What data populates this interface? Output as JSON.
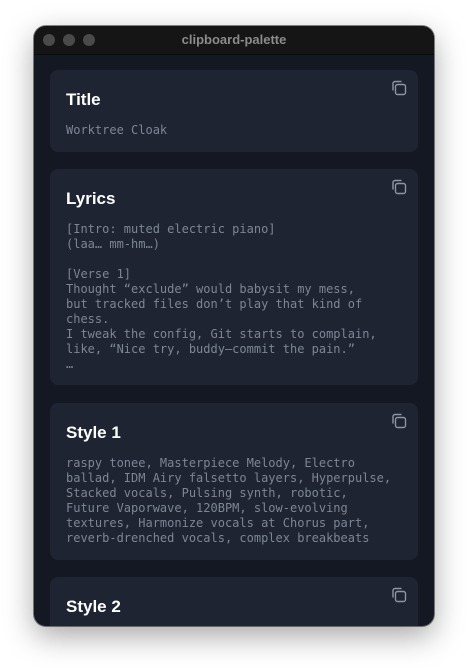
{
  "window": {
    "title": "clipboard-palette"
  },
  "cards": [
    {
      "title": "Title",
      "body": "Worktree Cloak"
    },
    {
      "title": "Lyrics",
      "body": "[Intro: muted electric piano]\n(laa… mm-hm…)\n\n[Verse 1]\nThought “exclude” would babysit my mess,\nbut tracked files don’t play that kind of\nchess.\nI tweak the config, Git starts to complain,\nlike, “Nice try, buddy—commit the pain.”\n…"
    },
    {
      "title": "Style 1",
      "body": "raspy tonee, Masterpiece Melody, Electro\nballad, IDM Airy falsetto layers, Hyperpulse,\nStacked vocals, Pulsing synth, robotic,\nFuture Vaporwave, 120BPM, slow-evolving\ntextures, Harmonize vocals at Chorus part,\nreverb-drenched vocals, complex breakbeats"
    },
    {
      "title": "Style 2",
      "body": ""
    }
  ],
  "icons": {
    "copy": "copy-icon"
  }
}
